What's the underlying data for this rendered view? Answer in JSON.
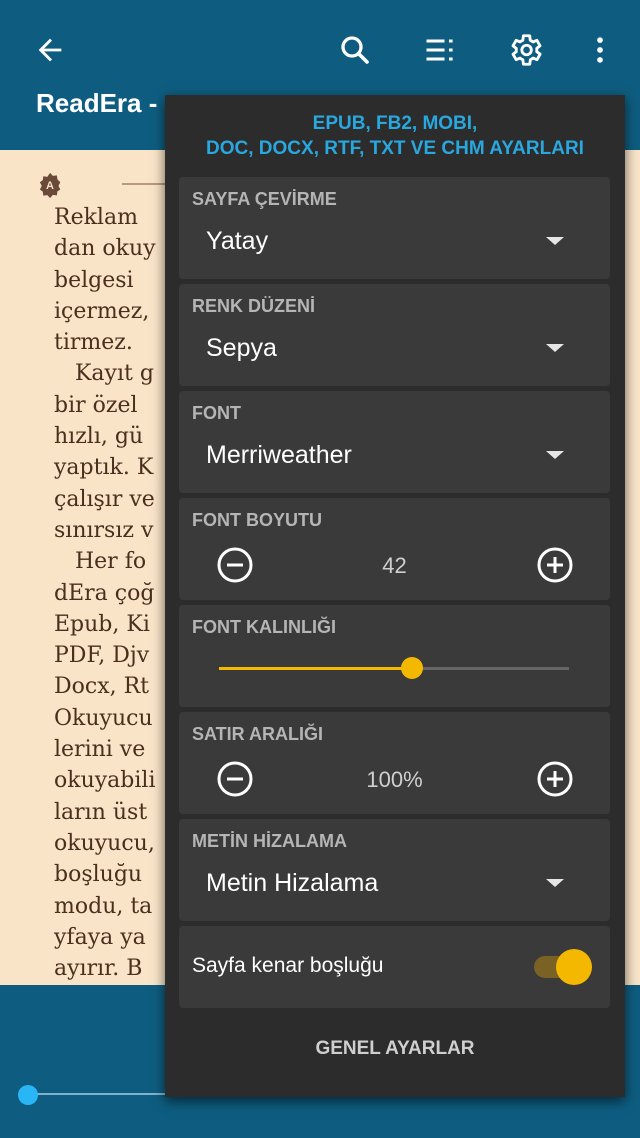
{
  "appbar": {
    "title": "ReadEra -",
    "back_icon": "arrow-left-icon",
    "search_icon": "search-icon",
    "contents_icon": "list-icon",
    "settings_icon": "gear-icon",
    "more_icon": "more-vertical-icon"
  },
  "book": {
    "lines": [
      "Reklam",
      "dan okuy",
      "belgesi",
      "içermez,",
      "tirmez.",
      "   Kayıt g",
      "bir özel",
      "hızlı, gü",
      "yaptık. K",
      "çalışır ve",
      "sınırsız v",
      "   Her fo",
      "dEra çoğ",
      "Epub, Ki",
      "PDF, Djv",
      "Docx, Rt",
      "Okuyucu",
      "lerini ve",
      "okuyabili",
      "ların üst",
      "okuyucu,",
      "boşluğu",
      "modu, ta",
      "yfaya ya",
      "ayırır. B"
    ]
  },
  "panel": {
    "heading_line1": "EPUB, FB2, MOBI,",
    "heading_line2": "DOC, DOCX, RTF, TXT VE CHM AYARLARI",
    "page_turn": {
      "label": "SAYFA ÇEVİRME",
      "value": "Yatay"
    },
    "color_scheme": {
      "label": "RENK DÜZENİ",
      "value": "Sepya"
    },
    "font": {
      "label": "FONT",
      "value": "Merriweather"
    },
    "font_size": {
      "label": "FONT BOYUTU",
      "value": "42"
    },
    "font_weight": {
      "label": "FONT KALINLIĞI",
      "level": 0.55
    },
    "line_spacing": {
      "label": "SATIR ARALIĞI",
      "value": "100%"
    },
    "text_align": {
      "label": "METİN HİZALAMA",
      "value": "Metin Hizalama"
    },
    "page_margin": {
      "label": "Sayfa kenar boşluğu",
      "enabled": true
    },
    "footer_button": "GENEL AYARLAR"
  },
  "progress": {
    "fraction": 0.0
  },
  "colors": {
    "appbar": "#0e5d80",
    "accent": "#f5b800",
    "heading": "#29a7df",
    "page": "#f9e4c8"
  }
}
